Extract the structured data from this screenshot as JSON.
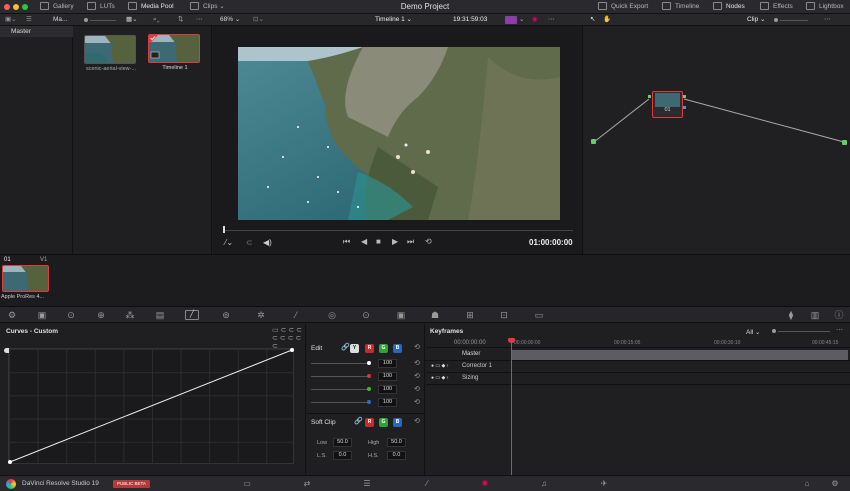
{
  "window": {
    "title": "Demo Project"
  },
  "topbar": {
    "gallery": "Gallery",
    "luts": "LUTs",
    "media_pool": "Media Pool",
    "clips": "Clips",
    "quick_export": "Quick Export",
    "timeline": "Timeline",
    "nodes": "Nodes",
    "effects": "Effects",
    "lightbox": "Lightbox"
  },
  "secbar": {
    "album": "Ma...",
    "zoom": "68%",
    "timeline_name": "Timeline 1",
    "timecode": "19:31:59:03",
    "clip_mode": "Clip"
  },
  "mediatree": {
    "master": "Master"
  },
  "pool": {
    "items": [
      {
        "label": "scenic-aerial-view-..."
      },
      {
        "label": "Timeline 1"
      }
    ]
  },
  "viewer": {
    "timecode": "01:00:00:00"
  },
  "nodes": {
    "node_label": "01"
  },
  "clipstrip": {
    "clip_number": "01",
    "track": "V1",
    "clip_label": "Apple ProRes 4..."
  },
  "curves": {
    "title": "Curves - Custom"
  },
  "edit": {
    "title": "Edit",
    "channels": [
      "Y",
      "R",
      "G",
      "B"
    ],
    "values": [
      "100",
      "100",
      "100",
      "100"
    ],
    "soft_clip": "Soft Clip",
    "low_label": "Low",
    "low_value": "50.0",
    "high_label": "High",
    "high_value": "50.0",
    "ls_label": "L.S.",
    "ls_value": "0.0",
    "hs_label": "H.S.",
    "hs_value": "0.0"
  },
  "keyframes": {
    "title": "Keyframes",
    "filter": "All",
    "ruler": [
      "00:00:00:00",
      "00:00:15:05",
      "00:00:30:10",
      "00:00:45:15"
    ],
    "current": "00:00:00:00",
    "tracks": [
      "Master",
      "Corrector 1",
      "Sizing"
    ]
  },
  "status": {
    "app": "DaVinci Resolve Studio 19",
    "badge": "PUBLIC BETA"
  },
  "colors": {
    "accent_red": "#e0393e",
    "panel_bg": "#1f1f22",
    "playhead": "#e0393e"
  }
}
